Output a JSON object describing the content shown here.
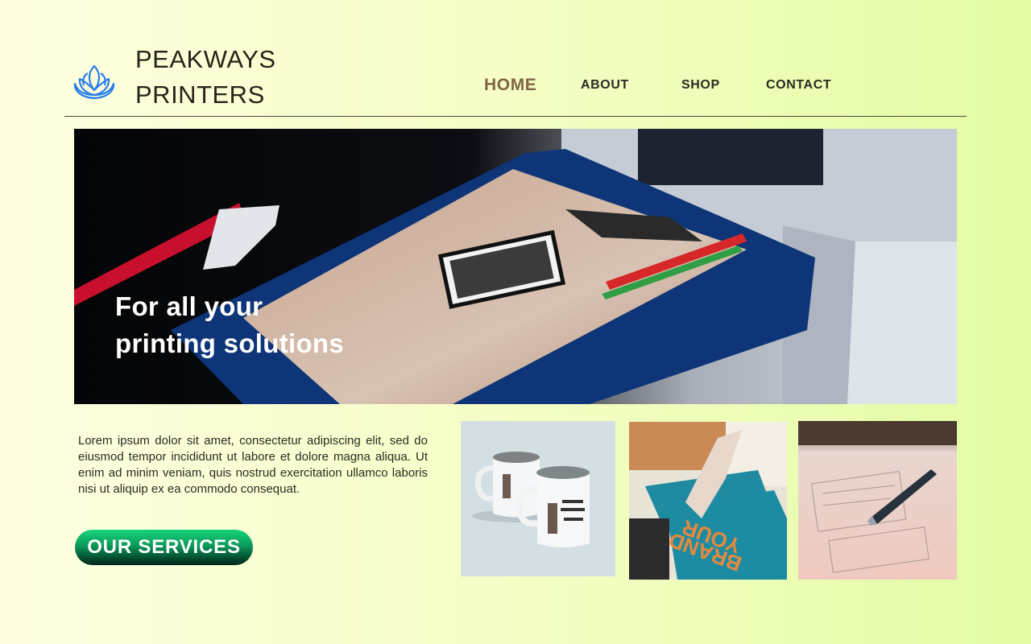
{
  "brand": {
    "line1": "PEAKWAYS",
    "line2": "PRINTERS",
    "logo_icon": "lotus-icon"
  },
  "nav": {
    "home": "HOME",
    "about": "ABOUT",
    "shop": "SHOP",
    "contact": "CONTACT",
    "active": "HOME"
  },
  "hero": {
    "line1": "For all your",
    "line2": "printing solutions",
    "image": "t-shirt-printer-photo"
  },
  "intro": {
    "text": "Lorem ipsum dolor sit amet, consectetur adipiscing elit, sed do eiusmod tempor incididunt ut labore et dolore magna aliqua. Ut enim ad minim veniam, quis nostrud exercitation ullamco laboris nisi ut aliquip ex ea commodo consequat."
  },
  "cta": {
    "label": "OUR SERVICES"
  },
  "gallery": [
    {
      "image": "printed-mugs-photo"
    },
    {
      "image": "screen-printed-tshirts-photo"
    },
    {
      "image": "pen-on-sketch-photo"
    }
  ],
  "colors": {
    "accent_nav": "#826445",
    "brand_text": "#2b2318",
    "cta_green": "#0b9a5a",
    "logo_blue": "#2b7de9"
  }
}
